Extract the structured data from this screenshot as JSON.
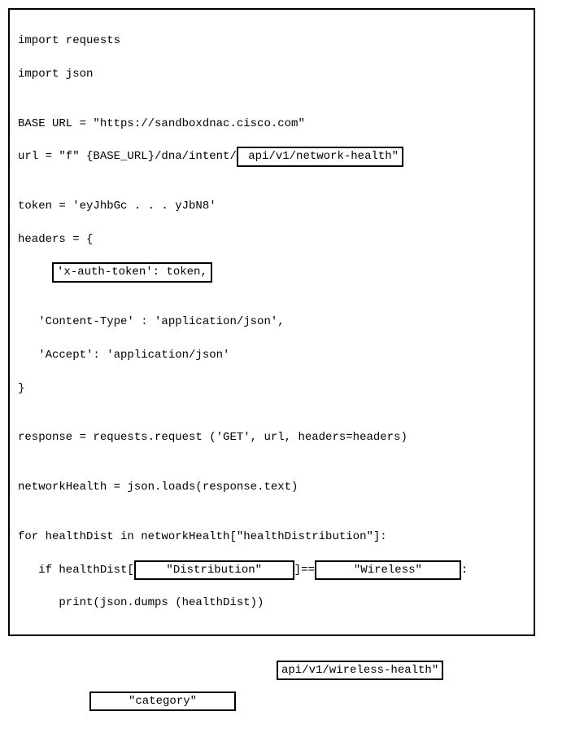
{
  "code": {
    "line1": "import requests",
    "line2": "import json",
    "line3": "",
    "line4_a": "BASE URL = \"https://sandboxdnac.cisco.com\"",
    "line5_a": "url = \"f\" {BASE_URL}/dna/intent/",
    "line5_box": " api/v1/network-health\"",
    "line6": "",
    "line7": "token = 'eyJhbGc . . . yJbN8'",
    "line8": "headers = {",
    "line9_indent": "     ",
    "line9_box": "'x-auth-token': token,",
    "line10": "",
    "line11": "   'Content-Type' : 'application/json',",
    "line12": "   'Accept': 'application/json'",
    "line13": "}",
    "line14": "",
    "line15": "response = requests.request ('GET', url, headers=headers)",
    "line16": "",
    "line17": "networkHealth = json.loads(response.text)",
    "line18": "",
    "line19": "for healthDist in networkHealth[\"healthDistribution\"]:",
    "line20_a": "   if healthDist[",
    "line20_box1": "    \"Distribution\"    ",
    "line20_mid": "]==",
    "line20_box2": "     \"Wireless\"     ",
    "line20_end": ":",
    "line21": "      print(json.dumps (healthDist))"
  },
  "floating": {
    "box1": "api/v1/wireless-health\"",
    "box2": "     \"category\"     "
  }
}
